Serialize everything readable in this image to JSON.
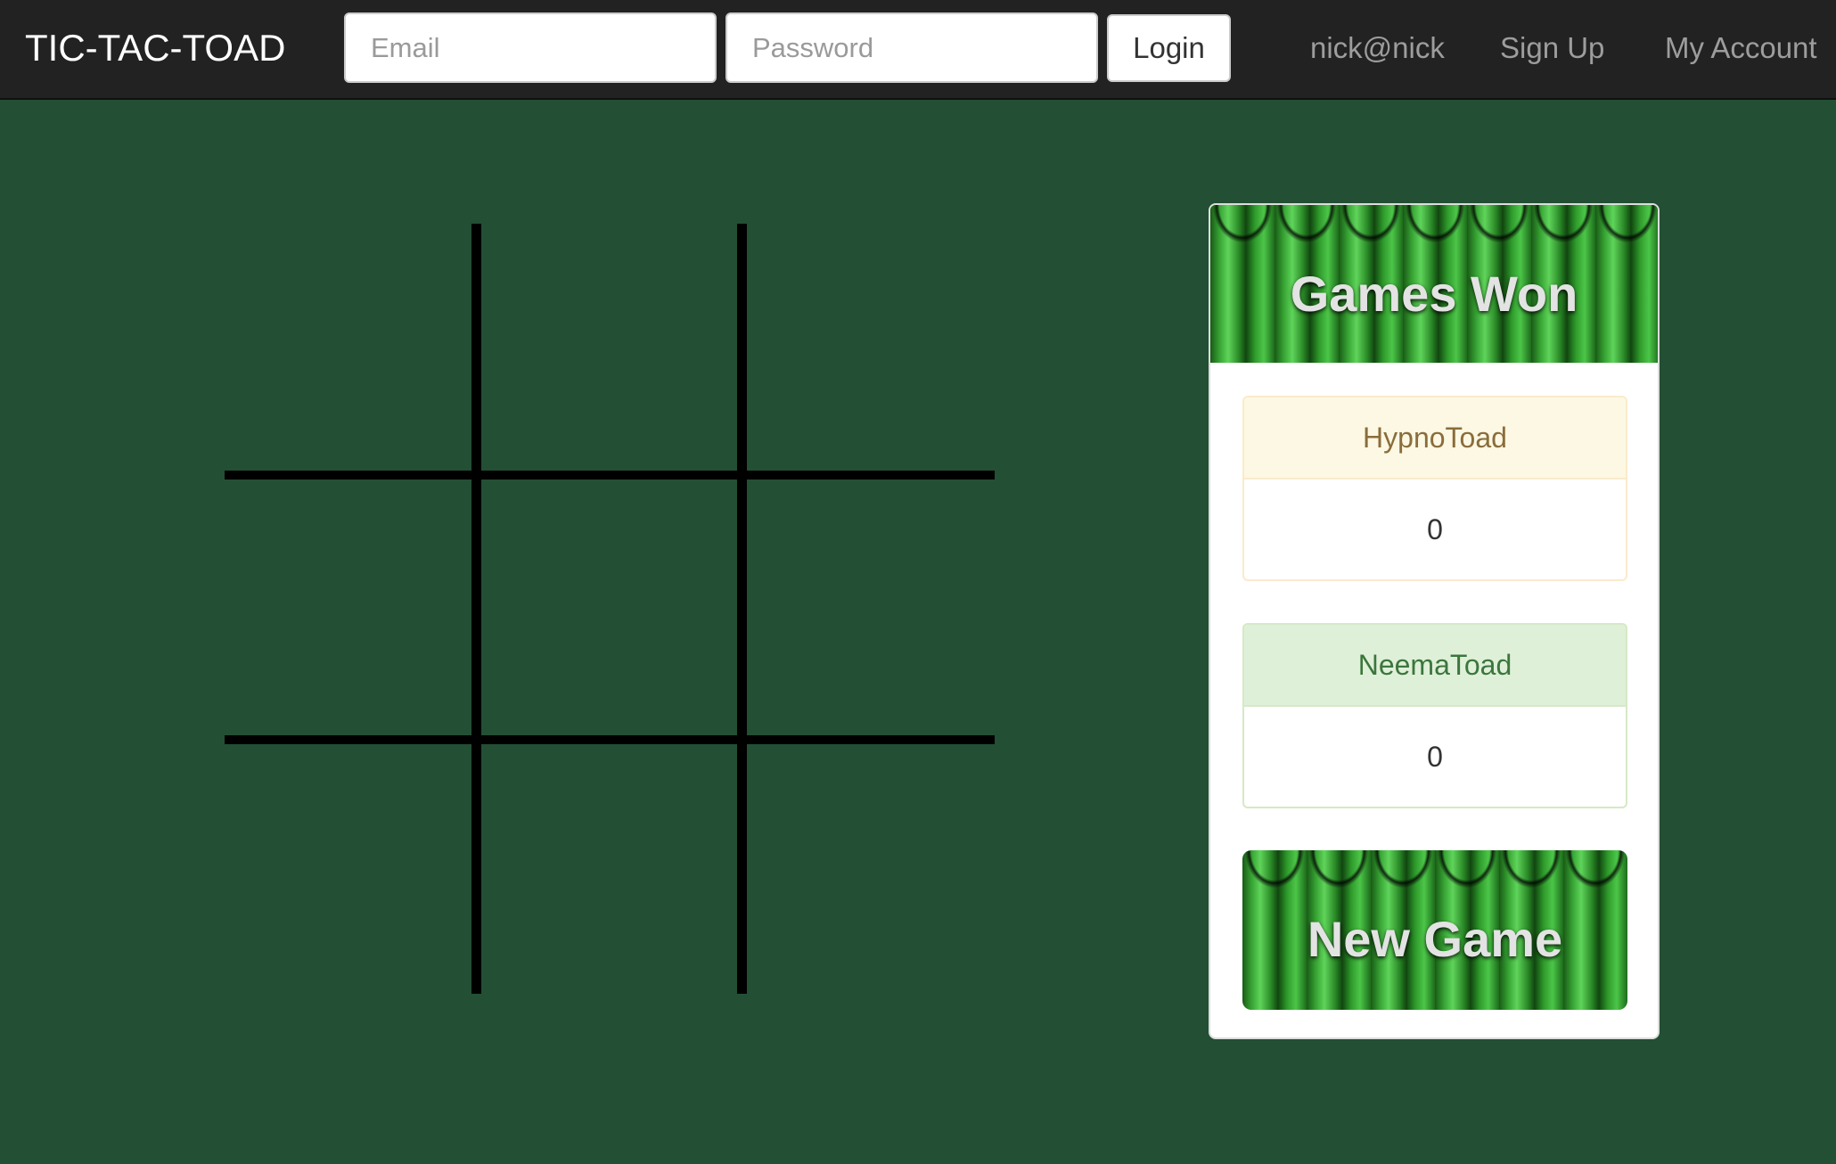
{
  "navbar": {
    "brand": "TIC-TAC-TOAD",
    "email_placeholder": "Email",
    "password_placeholder": "Password",
    "login_label": "Login",
    "user": "nick@nick",
    "signup_label": "Sign Up",
    "account_label": "My Account"
  },
  "board": {
    "cells": [
      "",
      "",
      "",
      "",
      "",
      "",
      "",
      "",
      ""
    ]
  },
  "scoreboard": {
    "title": "Games Won",
    "players": [
      {
        "name": "HypnoToad",
        "wins": "0"
      },
      {
        "name": "NeemaToad",
        "wins": "0"
      }
    ],
    "new_game_label": "New Game"
  },
  "colors": {
    "background": "#234f34",
    "navbar": "#222222",
    "grid_lines": "#000000",
    "player1_header": "#fcf8e3",
    "player2_header": "#dff0d8",
    "curtain_green": "#2c8a2a"
  }
}
